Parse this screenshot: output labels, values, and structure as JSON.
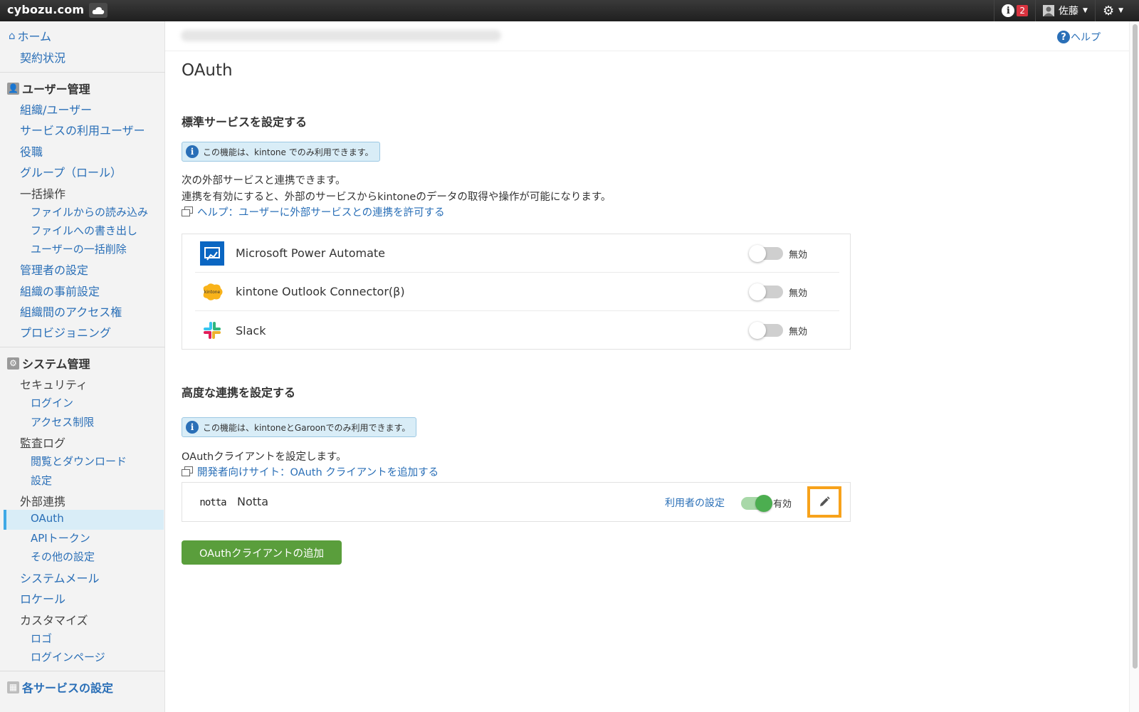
{
  "topbar": {
    "brand": "cybozu.com",
    "notification_count": "2",
    "user_name": "佐藤"
  },
  "sidebar": {
    "home": "ホーム",
    "contract": "契約状況",
    "user_mgmt_header": "ユーザー管理",
    "org_users": "組織/ユーザー",
    "service_users": "サービスの利用ユーザー",
    "roles": "役職",
    "groups": "グループ（ロール）",
    "bulk_ops": "一括操作",
    "import_file": "ファイルからの読み込み",
    "export_file": "ファイルへの書き出し",
    "bulk_delete": "ユーザーの一括削除",
    "admin_settings": "管理者の設定",
    "org_presettings": "組織の事前設定",
    "org_access": "組織間のアクセス権",
    "provisioning": "プロビジョニング",
    "system_mgmt_header": "システム管理",
    "security": "セキュリティ",
    "login": "ログイン",
    "access_control": "アクセス制限",
    "audit_log": "監査ログ",
    "browse_download": "閲覧とダウンロード",
    "audit_settings": "設定",
    "external": "外部連携",
    "oauth": "OAuth",
    "api_token": "APIトークン",
    "other_settings": "その他の設定",
    "system_mail": "システムメール",
    "locale": "ロケール",
    "customize": "カスタマイズ",
    "logo": "ロゴ",
    "login_page": "ログインページ",
    "each_service_header": "各サービスの設定"
  },
  "header": {
    "help": "ヘルプ"
  },
  "main": {
    "title": "OAuth",
    "standard": {
      "heading": "標準サービスを設定する",
      "note": "この機能は、kintone でのみ利用できます。",
      "desc1": "次の外部サービスと連携できます。",
      "desc2": "連携を有効にすると、外部のサービスからkintoneのデータの取得や操作が可能になります。",
      "help_link": "ヘルプ：ユーザーに外部サービスとの連携を許可する",
      "services": [
        {
          "name": "Microsoft Power Automate",
          "status": "無効",
          "enabled": false,
          "icon": "power-automate-icon"
        },
        {
          "name": "kintone Outlook Connector(β)",
          "status": "無効",
          "enabled": false,
          "icon": "kintone-icon"
        },
        {
          "name": "Slack",
          "status": "無効",
          "enabled": false,
          "icon": "slack-icon"
        }
      ]
    },
    "advanced": {
      "heading": "高度な連携を設定する",
      "note": "この機能は、kintoneとGaroonでのみ利用できます。",
      "desc": "OAuthクライアントを設定します。",
      "dev_link": "開発者向けサイト：OAuth クライアントを追加する",
      "client": {
        "logo_text": "notta",
        "name": "Notta",
        "users_link": "利用者の設定",
        "status": "有効",
        "enabled": true
      },
      "add_button": "OAuthクライアントの追加"
    }
  },
  "colors": {
    "link": "#2a6fb7",
    "add_button": "#5a9e3c",
    "toggle_on": "#4cae50",
    "highlight": "#f7a21b",
    "active_nav": "#d9edf7"
  }
}
